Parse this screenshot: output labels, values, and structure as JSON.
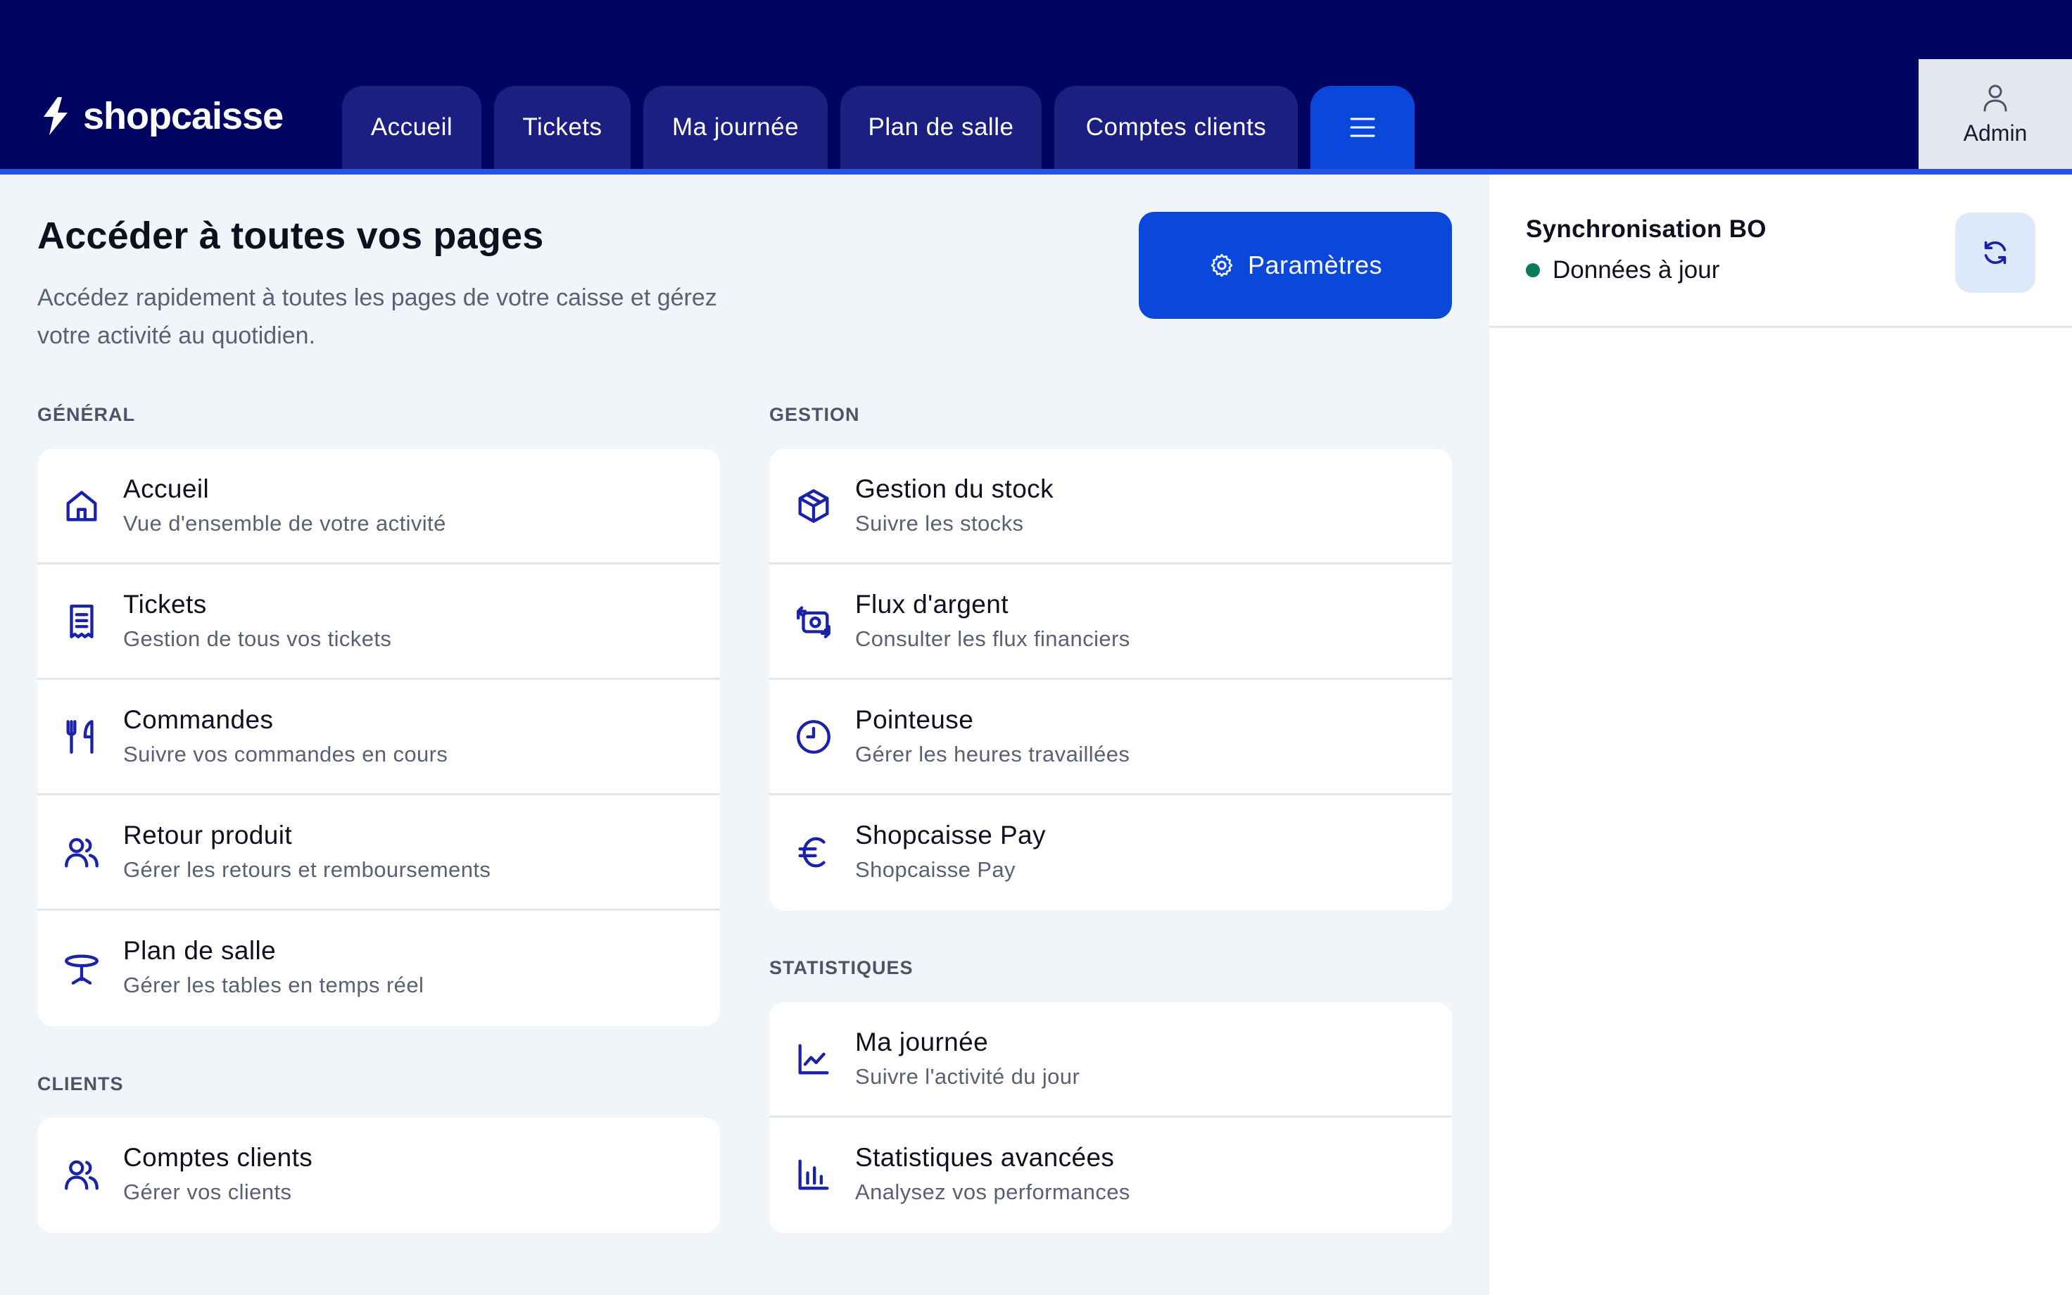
{
  "brand": {
    "name": "shopcaisse"
  },
  "nav": {
    "tabs": [
      {
        "label": "Accueil"
      },
      {
        "label": "Tickets"
      },
      {
        "label": "Ma journée"
      },
      {
        "label": "Plan de salle"
      },
      {
        "label": "Comptes clients"
      }
    ],
    "menu_icon": "hamburger-menu-icon",
    "user": {
      "label": "Admin",
      "icon": "user-icon"
    }
  },
  "page": {
    "title": "Accéder à toutes vos pages",
    "subtitle": "Accédez rapidement à toutes les pages de votre caisse et gérez votre activité au quotidien.",
    "settings_button": {
      "label": "Paramètres",
      "icon": "gear-icon"
    }
  },
  "sections": {
    "general": {
      "label": "GÉNÉRAL",
      "items": [
        {
          "title": "Accueil",
          "desc": "Vue d'ensemble de votre activité",
          "icon": "home-icon"
        },
        {
          "title": "Tickets",
          "desc": "Gestion de tous vos tickets",
          "icon": "receipt-icon"
        },
        {
          "title": "Commandes",
          "desc": "Suivre vos commandes en cours",
          "icon": "utensils-icon"
        },
        {
          "title": "Retour produit",
          "desc": "Gérer les retours et remboursements",
          "icon": "users-icon"
        },
        {
          "title": "Plan de salle",
          "desc": "Gérer les tables en temps réel",
          "icon": "table-icon"
        }
      ]
    },
    "clients": {
      "label": "CLIENTS",
      "items": [
        {
          "title": "Comptes clients",
          "desc": "Gérer vos clients",
          "icon": "users-icon"
        }
      ]
    },
    "gestion": {
      "label": "GESTION",
      "items": [
        {
          "title": "Gestion du stock",
          "desc": "Suivre les stocks",
          "icon": "box-icon"
        },
        {
          "title": "Flux d'argent",
          "desc": "Consulter les flux financiers",
          "icon": "cash-exchange-icon"
        },
        {
          "title": "Pointeuse",
          "desc": "Gérer les heures travaillées",
          "icon": "clock-icon"
        },
        {
          "title": "Shopcaisse Pay",
          "desc": "Shopcaisse Pay",
          "icon": "euro-icon"
        }
      ]
    },
    "statistiques": {
      "label": "STATISTIQUES",
      "items": [
        {
          "title": "Ma journée",
          "desc": "Suivre l'activité du jour",
          "icon": "line-chart-icon"
        },
        {
          "title": "Statistiques avancées",
          "desc": "Analysez vos performances",
          "icon": "bar-chart-icon"
        }
      ]
    }
  },
  "sync": {
    "title": "Synchronisation BO",
    "status": "Données à jour",
    "status_color": "#0d7a5a",
    "refresh_icon": "refresh-icon"
  },
  "colors": {
    "header_bg": "#000561",
    "tab_bg": "#1b1f82",
    "accent": "#0a48dc",
    "icon": "#1a22a8"
  }
}
